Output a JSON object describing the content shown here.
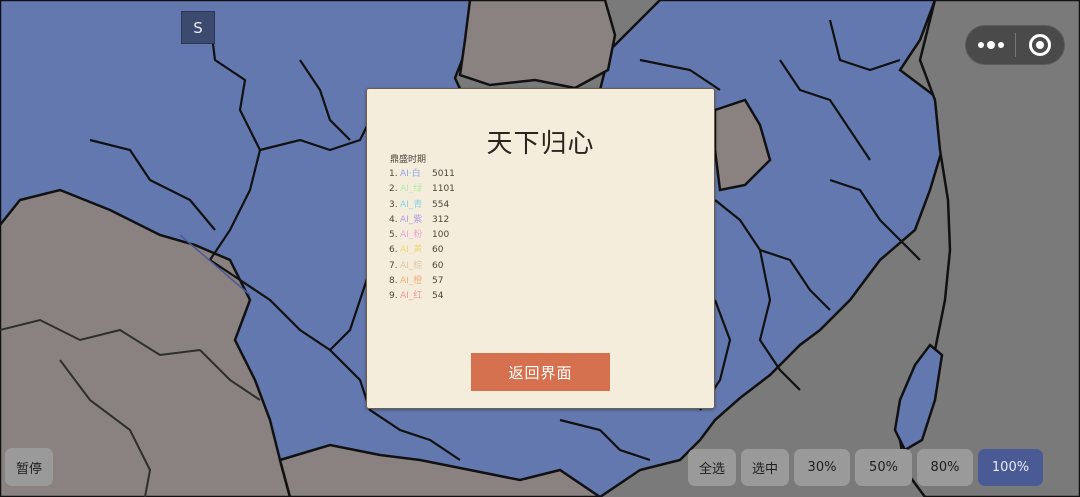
{
  "colors": {
    "sea_gray": "#7a7a7a",
    "neutral_land": "#898280",
    "owned_land": "#6478b0",
    "border": "#111111",
    "dialog_bg": "#f5eddc",
    "button_orange": "#d6714f",
    "active_button": "#4a5a94"
  },
  "badge": {
    "label": "S"
  },
  "capsule": {
    "more_icon": "more-dots-icon",
    "close_icon": "target-icon"
  },
  "dialog": {
    "title": "天下归心",
    "subtitle": "鼎盛时期",
    "rankings": [
      {
        "index": "1.",
        "name": "AI·白",
        "score": "5011",
        "color": "#8fa6e8"
      },
      {
        "index": "2.",
        "name": "AI_绿",
        "score": "1101",
        "color": "#b9e8a6"
      },
      {
        "index": "3.",
        "name": "AI_青",
        "score": "554",
        "color": "#86d5e6"
      },
      {
        "index": "4.",
        "name": "AI_紫",
        "score": "312",
        "color": "#b49ae6"
      },
      {
        "index": "5.",
        "name": "AI_粉",
        "score": "100",
        "color": "#eaa6d6"
      },
      {
        "index": "6.",
        "name": "AI_黄",
        "score": "60",
        "color": "#eed67c"
      },
      {
        "index": "7.",
        "name": "AI_棕",
        "score": "60",
        "color": "#e2c6a4"
      },
      {
        "index": "8.",
        "name": "AI_橙",
        "score": "57",
        "color": "#f0b07e"
      },
      {
        "index": "9.",
        "name": "AI_红",
        "score": "54",
        "color": "#ef9a9a"
      }
    ],
    "return_label": "返回界面"
  },
  "controls": {
    "pause": "暂停",
    "select_all": "全选",
    "selected": "选中",
    "p30": "30%",
    "p50": "50%",
    "p80": "80%",
    "p100": "100%",
    "active": "100%"
  }
}
